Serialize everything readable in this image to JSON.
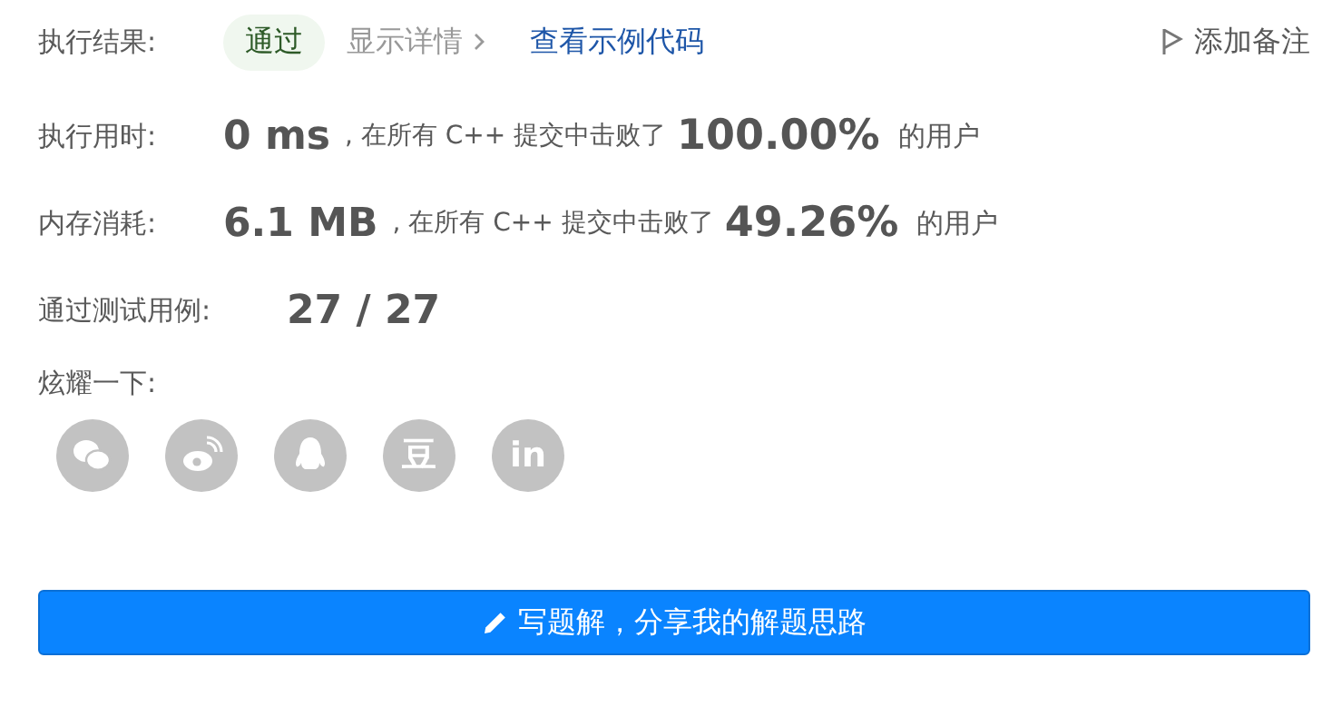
{
  "result": {
    "label": "执行结果:",
    "status": "通过",
    "details_link": "显示详情",
    "code_link": "查看示例代码",
    "note_button": "添加备注"
  },
  "stats": [
    {
      "label": "执行用时:",
      "value": "0 ms",
      "beat_text": ", 在所有 C++ 提交中击败了",
      "percent": "100.00%",
      "suffix": "的用户"
    },
    {
      "label": "内存消耗:",
      "value": "6.1 MB",
      "beat_text": ", 在所有 C++ 提交中击败了",
      "percent": "49.26%",
      "suffix": "的用户"
    }
  ],
  "tests": {
    "label": "通过测试用例:",
    "value": "27 / 27"
  },
  "share": {
    "label": "炫耀一下:",
    "items": [
      {
        "kind": "wechat"
      },
      {
        "kind": "weibo"
      },
      {
        "kind": "qq"
      },
      {
        "kind": "text",
        "glyph": "豆"
      },
      {
        "kind": "text",
        "glyph": "in"
      }
    ]
  },
  "solution_button": "写题解，分享我的解题思路"
}
